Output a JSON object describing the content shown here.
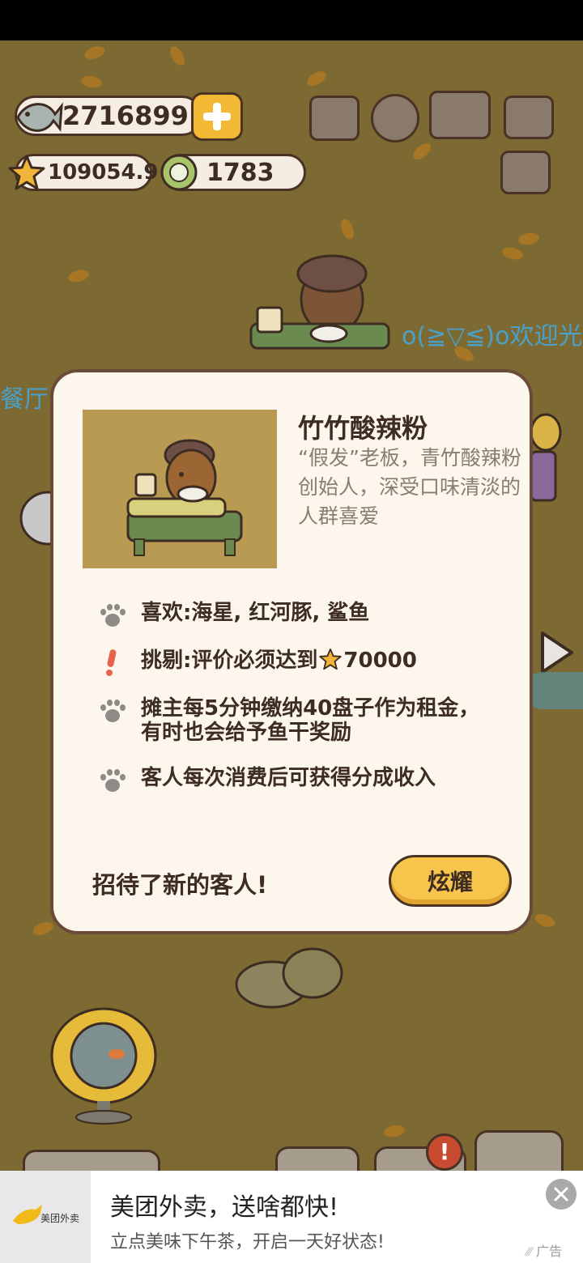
{
  "hud": {
    "fish_count": "2716899",
    "star_rating": "109054.9",
    "plate_count": "1783"
  },
  "scene": {
    "welcome_text": "o(≧▽≦)o欢迎光",
    "left_text": "餐厅"
  },
  "dialog": {
    "character_name": "竹竹酸辣粉",
    "character_desc": "“假发”老板，青竹酸辣粉创始人，深受口味清淡的人群喜爱",
    "likes": "喜欢:海星, 红河豚, 鲨鱼",
    "picky_prefix": "挑剔:评价必须达到",
    "picky_value": "70000",
    "rent_info": "摊主每5分钟缴纳40盘子作为租金，有时也会给予鱼干奖励",
    "income_info": "客人每次消费后可获得分成收入",
    "footer_message": "招待了新的客人!",
    "show_button": "炫耀"
  },
  "ad": {
    "brand": "美团外卖",
    "title": "美团外卖，送啥都快!",
    "subtitle": "立点美味下午茶，开启一天好状态!",
    "label": "广告"
  },
  "colors": {
    "background": "#7d6a32",
    "dialog_bg": "#fdf6ec",
    "accent_yellow": "#f7c44c",
    "text_dark": "#3d2c22",
    "desc_gray": "#8b7c71",
    "warning_red": "#e6634e"
  }
}
